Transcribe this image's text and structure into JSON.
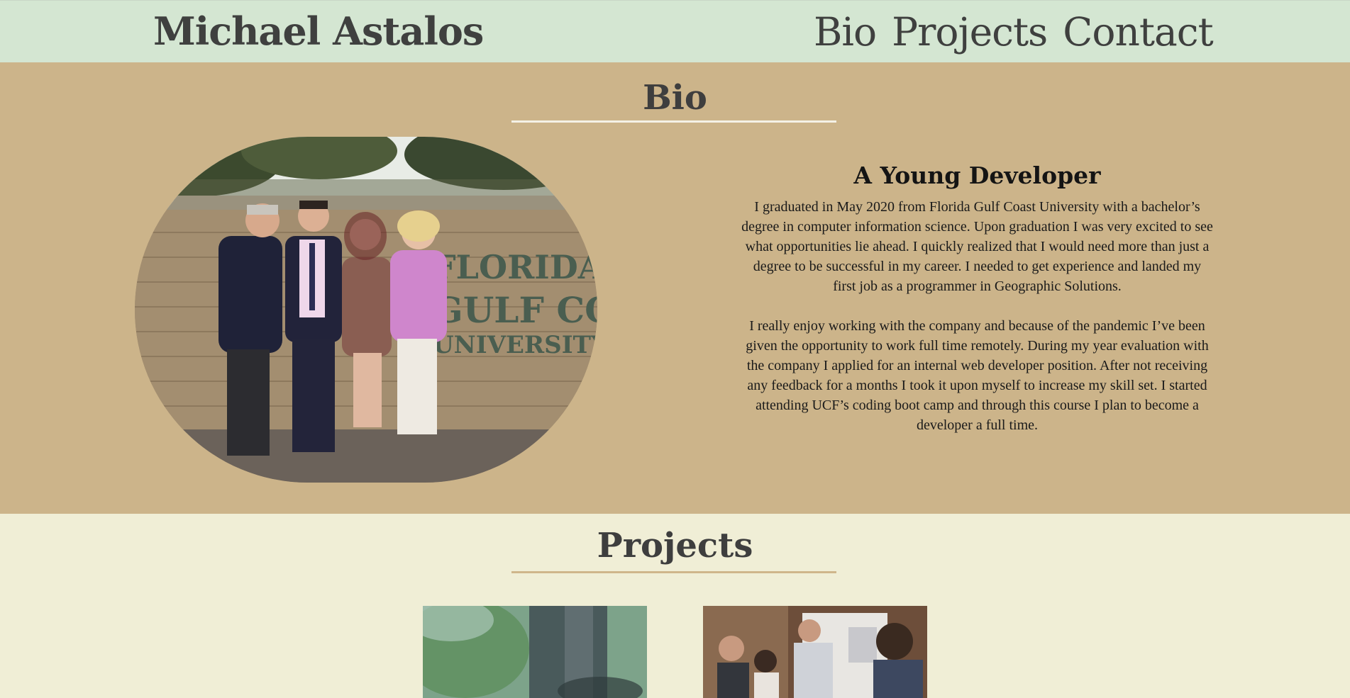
{
  "header": {
    "site_name": "Michael Astalos",
    "nav": [
      {
        "label": "Bio"
      },
      {
        "label": "Projects"
      },
      {
        "label": "Contact"
      }
    ]
  },
  "bio": {
    "title": "Bio",
    "photo_icon": "family-photo-at-university-sign",
    "photo_sign_text": [
      "FLORIDA",
      "GULF COAST",
      "UNIVERSITY"
    ],
    "subtitle": "A Young Developer",
    "paragraphs": [
      "I graduated in May 2020 from Florida Gulf Coast University with a bachelor’s degree in computer information science. Upon graduation I was very excited to see what opportunities lie ahead. I quickly realized that I would need more than just a degree to be successful in my career. I needed to get experience and landed my first job as a programmer in Geographic Solutions.",
      "I really enjoy working with the company and because of the pandemic I’ve been given the opportunity to work full time remotely. During my year evaluation with the company I applied for an internal web developer position. After not receiving any feedback for a months I took it upon myself to increase my skill set. I started attending UCF’s coding boot camp and through this course I plan to become a developer a full time."
    ]
  },
  "projects": {
    "title": "Projects",
    "cards": [
      {
        "image": "outdoor-person-photo"
      },
      {
        "image": "team-meeting-photo"
      }
    ]
  },
  "colors": {
    "header_bg": "#d4e6d2",
    "bio_bg": "#ccb48a",
    "projects_bg": "#f0eed6",
    "heading_text": "#3e3e3e"
  }
}
